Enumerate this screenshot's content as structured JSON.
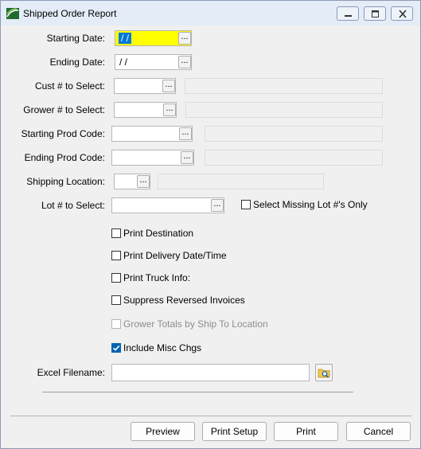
{
  "window": {
    "title": "Shipped Order Report"
  },
  "form": {
    "starting_date": {
      "label": "Starting Date:",
      "value": "/ /"
    },
    "ending_date": {
      "label": "Ending Date:",
      "value": " / /"
    },
    "cust": {
      "label": "Cust # to Select:"
    },
    "grower": {
      "label": "Grower # to Select:"
    },
    "start_prod": {
      "label": "Starting Prod Code:"
    },
    "end_prod": {
      "label": "Ending Prod Code:"
    },
    "ship_loc": {
      "label": "Shipping Location:"
    },
    "lot": {
      "label": "Lot # to Select:"
    },
    "excel": {
      "label": "Excel Filename:"
    },
    "ellipsis": "..."
  },
  "checkboxes": {
    "missing_lot": {
      "label": "Select Missing Lot #'s Only",
      "checked": false
    },
    "print_destination": {
      "label": "Print Destination",
      "checked": false
    },
    "print_delivery": {
      "label": "Print Delivery Date/Time",
      "checked": false
    },
    "print_truck": {
      "label": "Print Truck Info:",
      "checked": false
    },
    "suppress_reversed": {
      "label": "Suppress Reversed Invoices",
      "checked": false
    },
    "grower_totals": {
      "label": "Grower Totals by Ship To Location",
      "checked": false,
      "disabled": true
    },
    "include_misc": {
      "label": "Include Misc Chgs",
      "checked": true
    }
  },
  "buttons": {
    "preview": "Preview",
    "print_setup": "Print Setup",
    "print": "Print",
    "cancel": "Cancel"
  }
}
